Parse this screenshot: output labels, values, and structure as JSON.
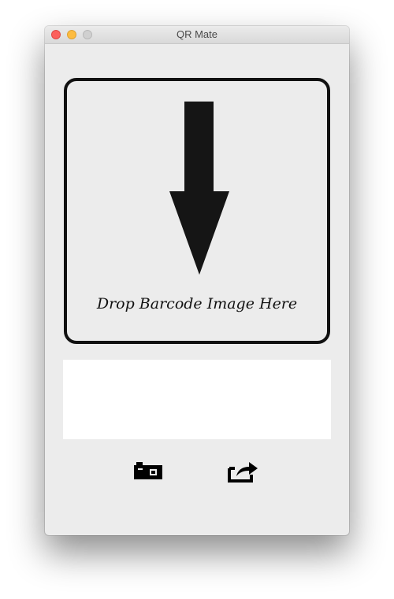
{
  "window": {
    "title": "QR Mate"
  },
  "dropzone": {
    "label": "Drop Barcode Image Here",
    "icon": "arrow-down-icon"
  },
  "result": {
    "value": ""
  },
  "toolbar": {
    "camera_icon": "camera-icon",
    "share_icon": "share-icon"
  },
  "colors": {
    "window_bg": "#ececec",
    "border": "#111111",
    "close": "#fc605c",
    "minimize": "#fdbc40",
    "zoom": "#d0d0d0"
  }
}
